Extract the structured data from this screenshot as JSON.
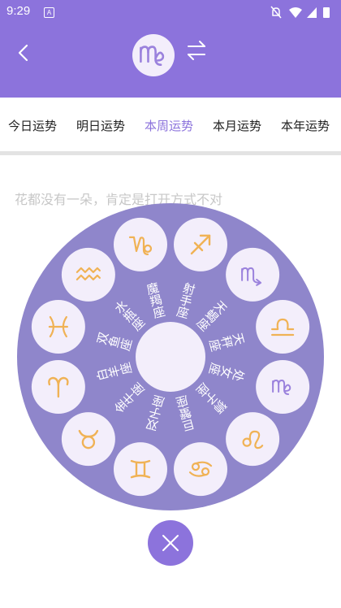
{
  "status_bar": {
    "time": "9:29",
    "badge": "A"
  },
  "header": {
    "current_sign_icon": "virgo-icon"
  },
  "tabs": [
    {
      "label": "今日运势"
    },
    {
      "label": "明日运势"
    },
    {
      "label": "本周运势",
      "active": true
    },
    {
      "label": "本月运势"
    },
    {
      "label": "本年运势"
    }
  ],
  "hint": "花都没有一朵，肯定是打开方式不对",
  "signs": [
    {
      "name": "魔羯座",
      "icon": "capricorn-icon"
    },
    {
      "name": "射手座",
      "icon": "sagittarius-icon"
    },
    {
      "name": "天蝎座",
      "icon": "scorpio-icon"
    },
    {
      "name": "天秤座",
      "icon": "libra-icon"
    },
    {
      "name": "处女座",
      "icon": "virgo-icon"
    },
    {
      "name": "狮子座",
      "icon": "leo-icon"
    },
    {
      "name": "巨蟹座",
      "icon": "cancer-icon"
    },
    {
      "name": "双子座",
      "icon": "gemini-icon"
    },
    {
      "name": "金牛座",
      "icon": "taurus-icon"
    },
    {
      "name": "白羊座",
      "icon": "aries-icon"
    },
    {
      "name": "双鱼座",
      "icon": "pisces-icon"
    },
    {
      "name": "水瓶座",
      "icon": "aquarius-icon"
    }
  ],
  "colors": {
    "accent": "#8c73dc",
    "wheel": "#8f86cb",
    "badge_bg": "#f3eefb",
    "symbol_orange": "#f0b255",
    "symbol_purple": "#9b82dd"
  }
}
